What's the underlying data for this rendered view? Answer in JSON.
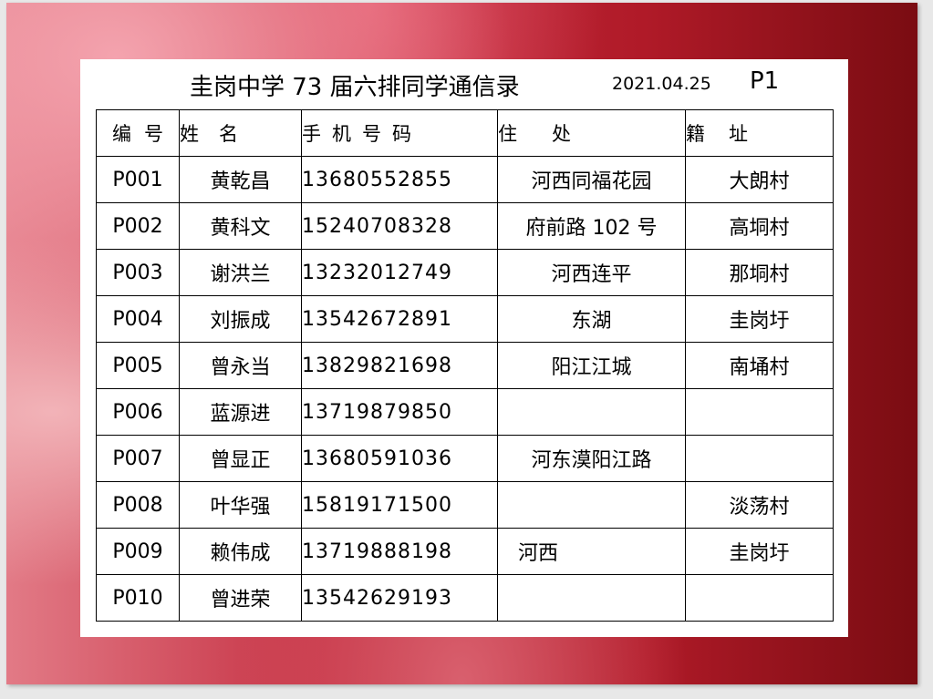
{
  "header": {
    "title": "圭岗中学 73 届六排同学通信录",
    "date": "2021.04.25",
    "page": "P1"
  },
  "columns": {
    "id": "编号",
    "name": "姓名",
    "phone": "手机号码",
    "address": "住处",
    "hometown": "籍址"
  },
  "rows": [
    {
      "id": "P001",
      "name": "黄乾昌",
      "phone": "13680552855",
      "address": "河西同福花园",
      "hometown": "大朗村"
    },
    {
      "id": "P002",
      "name": "黄科文",
      "phone": "15240708328",
      "address": "府前路 102 号",
      "hometown": "高垌村"
    },
    {
      "id": "P003",
      "name": "谢洪兰",
      "phone": "13232012749",
      "address": "河西连平",
      "hometown": "那垌村"
    },
    {
      "id": "P004",
      "name": "刘振成",
      "phone": "13542672891",
      "address": "东湖",
      "hometown": "圭岗圩"
    },
    {
      "id": "P005",
      "name": "曾永当",
      "phone": "13829821698",
      "address": "阳江江城",
      "hometown": "南埇村"
    },
    {
      "id": "P006",
      "name": "蓝源进",
      "phone": "13719879850",
      "address": "",
      "hometown": ""
    },
    {
      "id": "P007",
      "name": "曾显正",
      "phone": "13680591036",
      "address": "河东漠阳江路",
      "hometown": ""
    },
    {
      "id": "P008",
      "name": "叶华强",
      "phone": "15819171500",
      "address": "",
      "hometown": "淡荡村"
    },
    {
      "id": "P009",
      "name": "赖伟成",
      "phone": "13719888198",
      "address": "河西",
      "hometown": "圭岗圩"
    },
    {
      "id": "P010",
      "name": "曾进荣",
      "phone": "13542629193",
      "address": "",
      "hometown": ""
    }
  ]
}
